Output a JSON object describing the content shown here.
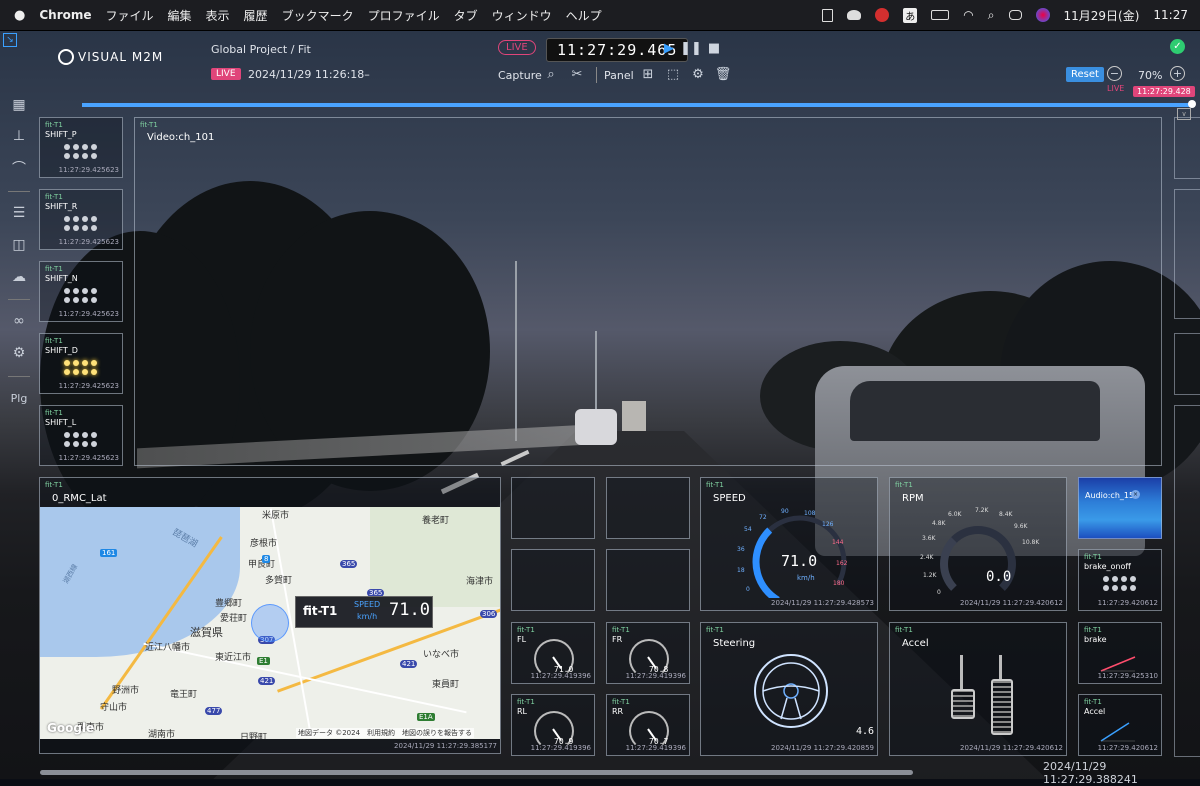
{
  "menubar": {
    "app": "Chrome",
    "items": [
      "ファイル",
      "編集",
      "表示",
      "履歴",
      "ブックマーク",
      "プロファイル",
      "タブ",
      "ウィンドウ",
      "ヘルプ"
    ],
    "ime": "あ",
    "date": "11月29日(金)",
    "time": "11:27"
  },
  "header": {
    "logo": "VISUAL M2M",
    "breadcrumb": "Global Project / Fit",
    "live": "LIVE",
    "session_time": "2024/11/29 11:26:18–",
    "clock": "11:27:29.465",
    "capture": "Capture",
    "panel": "Panel",
    "reset": "Reset",
    "zoom": "70%",
    "timeline_marker": "11:27:29.428",
    "timeline_live": "LIVE"
  },
  "sidebar": {
    "plg": "Plg",
    "icons": [
      "grid-icon",
      "tree-icon",
      "chart-icon",
      "list-icon",
      "database-icon",
      "cloud-upload-icon",
      "link-icon",
      "gear-icon"
    ]
  },
  "shift_panels": [
    {
      "tag": "fit-T1",
      "name": "SHIFT_P",
      "ts": "11:27:29.425623",
      "active": false
    },
    {
      "tag": "fit-T1",
      "name": "SHIFT_R",
      "ts": "11:27:29.425623",
      "active": false
    },
    {
      "tag": "fit-T1",
      "name": "SHIFT_N",
      "ts": "11:27:29.425623",
      "active": false
    },
    {
      "tag": "fit-T1",
      "name": "SHIFT_D",
      "ts": "11:27:29.425623",
      "active": true
    },
    {
      "tag": "fit-T1",
      "name": "SHIFT_L",
      "ts": "11:27:29.425623",
      "active": false
    }
  ],
  "video": {
    "tag": "fit-T1",
    "name": "Video:ch_101"
  },
  "map_panel": {
    "tag": "fit-T1",
    "name": "0_RMC_Lat",
    "overlay_name": "fit-T1",
    "overlay_speed_label": "SPEED",
    "overlay_unit": "km/h",
    "overlay_value": "71.0",
    "attribution": "地図データ ©2024　利用規約　地図の誤りを報告する",
    "google": "Google",
    "ts": "2024/11/29 11:27:29.385177",
    "labels": [
      "米原市",
      "養老町",
      "彦根市",
      "甲良町",
      "多賀町",
      "豊郷町",
      "愛荘町",
      "滋賀県",
      "近江八幡市",
      "東近江市",
      "野洲市",
      "竜王町",
      "守山市",
      "栗東市",
      "湖南市",
      "日野町",
      "いなべ市",
      "東員町",
      "海津市",
      "琵琶湖",
      "湖西線"
    ],
    "shields": [
      "161",
      "8",
      "365",
      "307",
      "E1",
      "421",
      "477",
      "421",
      "E1A",
      "306",
      "365"
    ]
  },
  "wheels": [
    {
      "tag": "fit-T1",
      "name": "FL",
      "value": "71.0",
      "ts": "11:27:29.419396"
    },
    {
      "tag": "fit-T1",
      "name": "FR",
      "value": "70.8",
      "ts": "11:27:29.419396"
    },
    {
      "tag": "fit-T1",
      "name": "RL",
      "value": "70.9",
      "ts": "11:27:29.419396"
    },
    {
      "tag": "fit-T1",
      "name": "RR",
      "value": "70.7",
      "ts": "11:27:29.419396"
    }
  ],
  "speed": {
    "tag": "fit-T1",
    "name": "SPEED",
    "value": "71.0",
    "unit": "km/h",
    "ts": "2024/11/29 11:27:29.428573",
    "ticks": [
      "0",
      "18",
      "36",
      "54",
      "72",
      "90",
      "108",
      "126",
      "144",
      "162",
      "180"
    ],
    "fraction": 0.394
  },
  "rpm": {
    "tag": "fit-T1",
    "name": "RPM",
    "value": "0.0",
    "ts": "2024/11/29 11:27:29.420612",
    "ticks": [
      "0",
      "1.2K",
      "2.4K",
      "3.6K",
      "4.8K",
      "6.0K",
      "7.2K",
      "8.4K",
      "9.6K",
      "10.8K"
    ]
  },
  "steering": {
    "tag": "fit-T1",
    "name": "Steering",
    "value": "4.6",
    "ts": "2024/11/29 11:27:29.420859"
  },
  "accel_panel": {
    "tag": "fit-T1",
    "name": "Accel",
    "ts": "2024/11/29 11:27:29.420612"
  },
  "audio": {
    "name": "Audio:ch_150"
  },
  "brake_onoff": {
    "tag": "fit-T1",
    "name": "brake_onoff",
    "ts": "11:27:29.420612"
  },
  "brake": {
    "tag": "fit-T1",
    "name": "brake",
    "ts": "11:27:29.425310"
  },
  "accel_small": {
    "tag": "fit-T1",
    "name": "Accel",
    "ts": "11:27:29.420612"
  },
  "footer": {
    "timestamp": "2024/11/29 11:27:29.388241"
  },
  "colors": {
    "accent": "#3aa0ff",
    "live": "#e0457a",
    "ok": "#2ecc71",
    "gauge": "#2e8fff",
    "brake": "#ff4d6d"
  }
}
